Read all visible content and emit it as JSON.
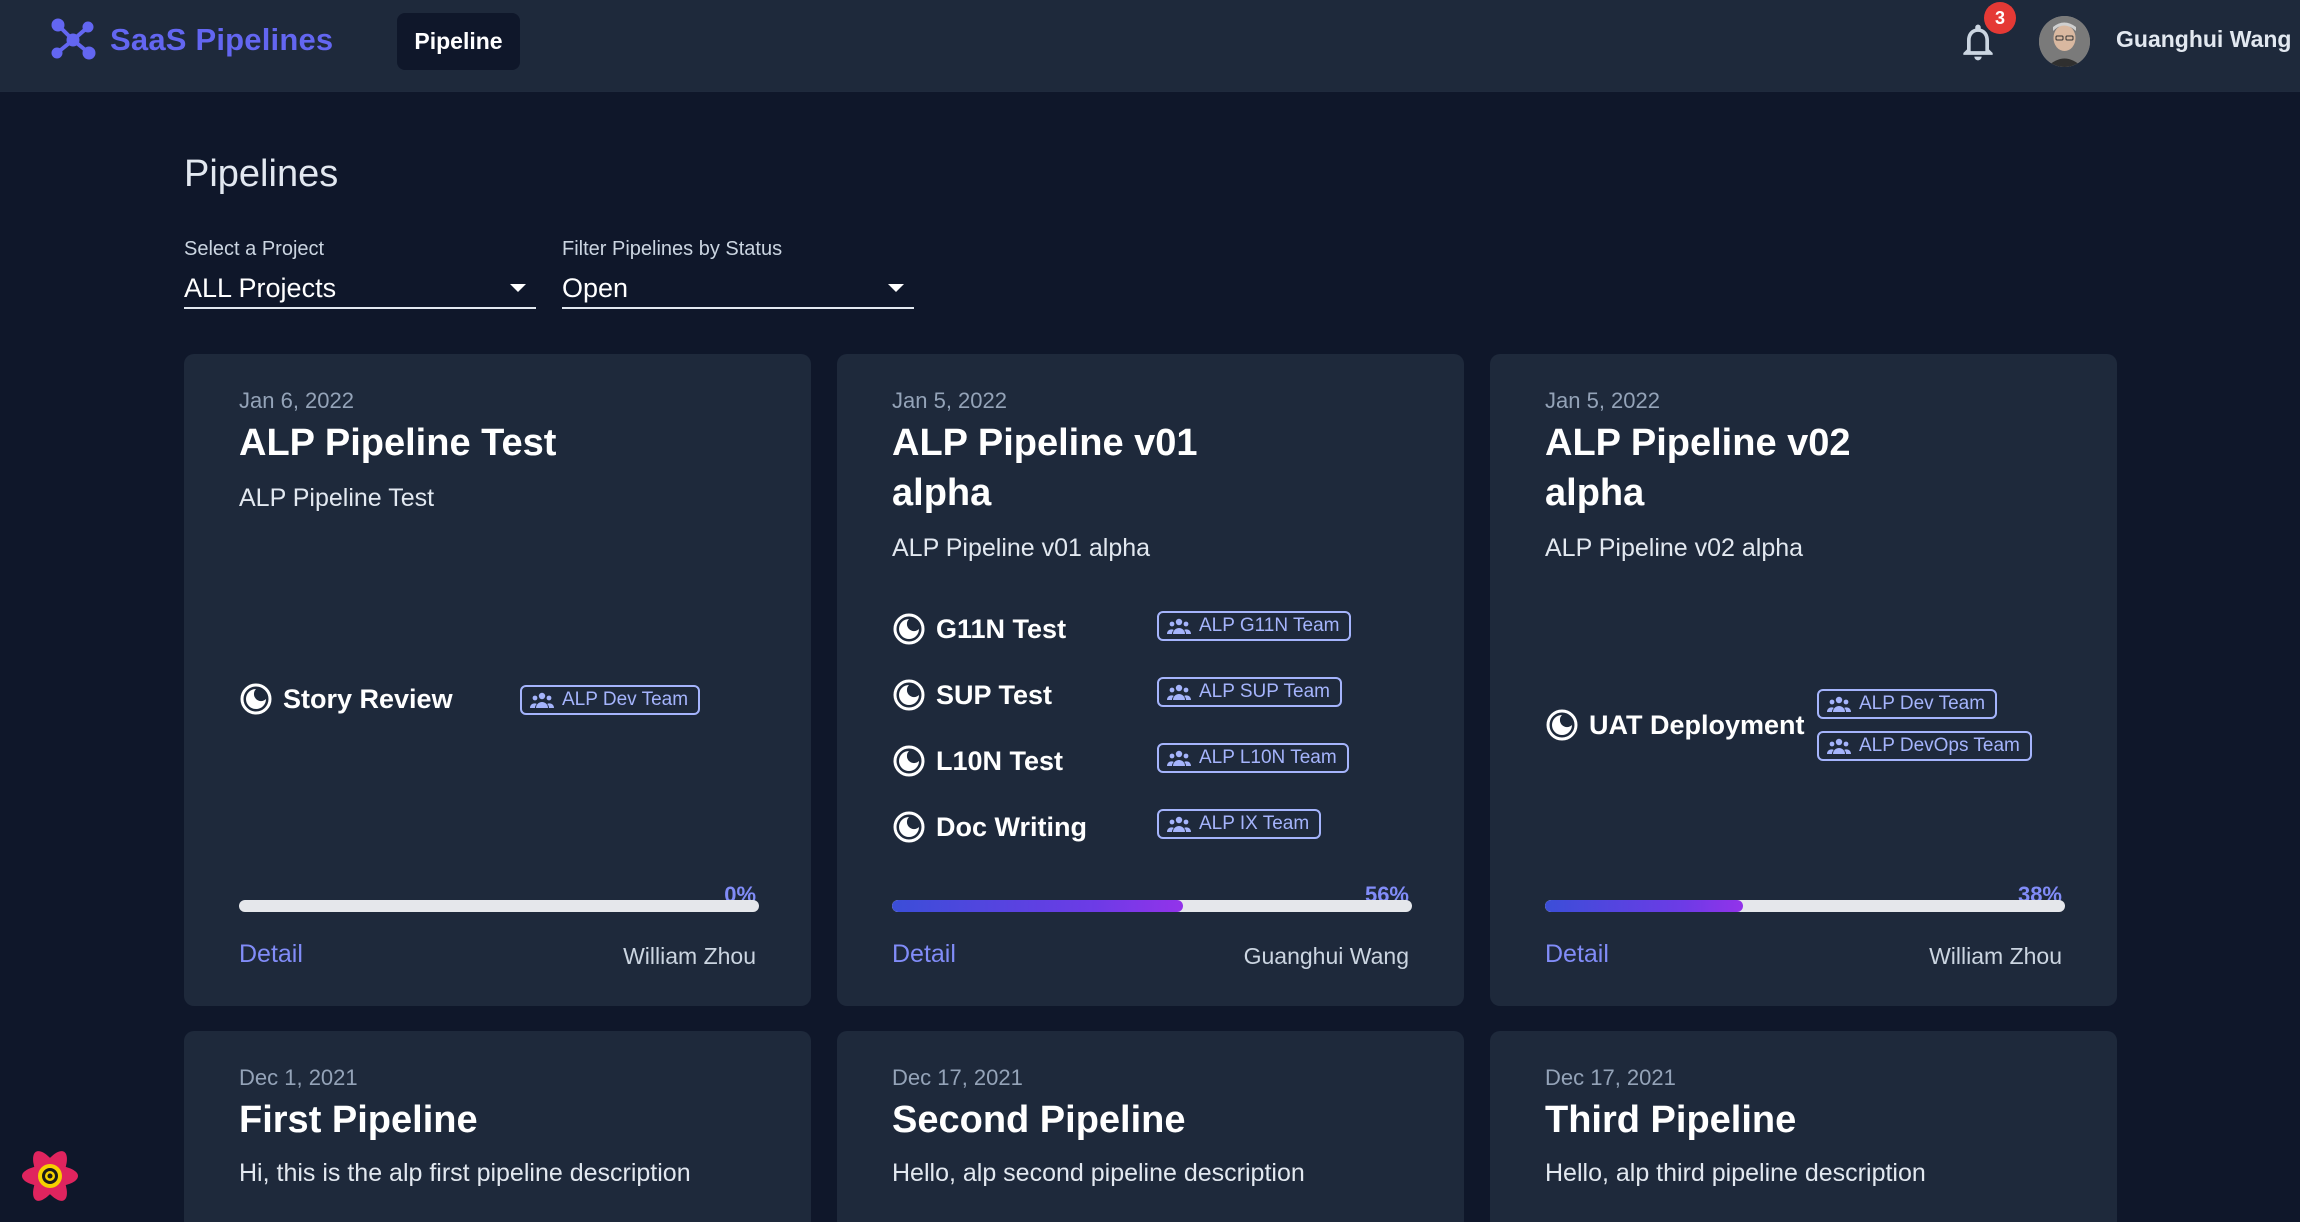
{
  "header": {
    "app_name": "SaaS Pipelines",
    "nav_item": "Pipeline",
    "notification_count": "3",
    "user_name": "Guanghui Wang",
    "brand_color": "#6366f1"
  },
  "page": {
    "title": "Pipelines",
    "project_filter": {
      "label": "Select a Project",
      "value": "ALL Projects"
    },
    "status_filter": {
      "label": "Filter Pipelines by Status",
      "value": "Open"
    }
  },
  "cards": [
    {
      "date": "Jan 6, 2022",
      "title": "ALP Pipeline Test",
      "description": "ALP Pipeline Test",
      "stages": [
        {
          "name": "Story Review",
          "teams": [
            "ALP Dev Team"
          ]
        }
      ],
      "progress_label": "0%",
      "progress": 0,
      "detail": "Detail",
      "owner": "William Zhou"
    },
    {
      "date": "Jan 5, 2022",
      "title": "ALP Pipeline v01 alpha",
      "description": "ALP Pipeline v01 alpha",
      "stages": [
        {
          "name": "G11N Test",
          "teams": [
            "ALP G11N Team"
          ]
        },
        {
          "name": "SUP Test",
          "teams": [
            "ALP SUP Team"
          ]
        },
        {
          "name": "L10N Test",
          "teams": [
            "ALP L10N Team"
          ]
        },
        {
          "name": "Doc Writing",
          "teams": [
            "ALP IX Team"
          ]
        }
      ],
      "progress_label": "56%",
      "progress": 0.56,
      "detail": "Detail",
      "owner": "Guanghui Wang"
    },
    {
      "date": "Jan 5, 2022",
      "title": "ALP Pipeline v02 alpha",
      "description": "ALP Pipeline v02 alpha",
      "stages": [
        {
          "name": "UAT Deployment",
          "teams": [
            "ALP Dev Team",
            "ALP DevOps Team"
          ]
        }
      ],
      "progress_label": "38%",
      "progress": 0.38,
      "detail": "Detail",
      "owner": "William Zhou"
    },
    {
      "date": "Dec 1, 2021",
      "title": "First Pipeline",
      "description": "Hi, this is the alp first pipeline description"
    },
    {
      "date": "Dec 17, 2021",
      "title": "Second Pipeline",
      "description": "Hello, alp second pipeline description"
    },
    {
      "date": "Dec 17, 2021",
      "title": "Third Pipeline",
      "description": "Hello, alp third pipeline description"
    }
  ],
  "icons": {
    "logo": "network-logo-icon",
    "notifications": "bell-icon",
    "stage": "half-moon-icon",
    "team": "people-icon",
    "devtools": "react-devtools-icon"
  }
}
